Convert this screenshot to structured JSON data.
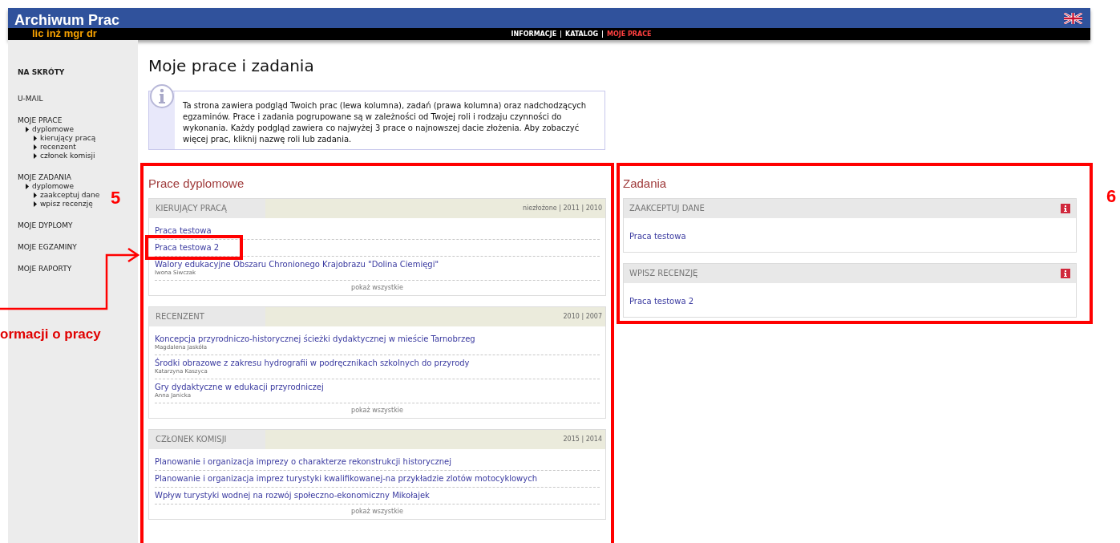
{
  "header": {
    "title": "Archiwum Prac",
    "subtitle": "lic inż mgr dr",
    "separator": "|",
    "nav": [
      {
        "label": "INFORMACJE",
        "selected": false
      },
      {
        "label": "KATALOG",
        "selected": false
      },
      {
        "label": "MOJE PRACE",
        "selected": true
      }
    ]
  },
  "sidebar": {
    "heading": "NA SKRÓTY",
    "items": [
      {
        "label": "U-MAIL"
      },
      {
        "label": "MOJE PRACE",
        "children": [
          {
            "label": "dyplomowe",
            "children": [
              {
                "label": "kierujący pracą"
              },
              {
                "label": "recenzent"
              },
              {
                "label": "członek komisji"
              }
            ]
          }
        ]
      },
      {
        "label": "MOJE ZADANIA",
        "children": [
          {
            "label": "dyplomowe",
            "children": [
              {
                "label": "zaakceptuj dane"
              },
              {
                "label": "wpisz recenzję"
              }
            ]
          }
        ]
      },
      {
        "label": "MOJE DYPLOMY"
      },
      {
        "label": "MOJE EGZAMINY"
      },
      {
        "label": "MOJE RAPORTY"
      }
    ]
  },
  "page_title": "Moje prace i zadania",
  "info_text": "Ta strona zawiera podgląd Twoich prac (lewa kolumna), zadań (prawa kolumna) oraz nadchodzących egzaminów. Prace i zadania pogrupowane są w zależności od Twojej roli i rodzaju czynności do wykonania. Każdy podgląd zawiera co najwyżej 3 prace o najnowszej dacie złożenia. Aby zobaczyć więcej prac, kliknij nazwę roli lub zadania.",
  "theses": {
    "title": "Prace dyplomowe",
    "groups": [
      {
        "heading": "KIERUJĄCY PRACĄ",
        "filters": "niezłożone | 2011 | 2010",
        "show_all": "pokaż wszystkie",
        "items": [
          {
            "title": "Praca testowa"
          },
          {
            "title": "Praca testowa 2",
            "highlighted": true
          },
          {
            "title": "Walory edukacyjne Obszaru Chronionego Krajobrazu \"Dolina Ciemięgi\"",
            "author": "Iwona Siwczak"
          }
        ]
      },
      {
        "heading": "RECENZENT",
        "filters": "2010 | 2007",
        "show_all": "pokaż wszystkie",
        "items": [
          {
            "title": "Koncepcja przyrodniczo-historycznej ścieżki dydaktycznej w mieście Tarnobrzeg",
            "author": "Magdalena Jaskóła"
          },
          {
            "title": "Środki obrazowe z zakresu hydrografii w podręcznikach szkolnych do przyrody",
            "author": "Katarzyna Kaszyca"
          },
          {
            "title": "Gry dydaktyczne w edukacji przyrodniczej",
            "author": "Anna Janicka"
          }
        ]
      },
      {
        "heading": "CZŁONEK KOMISJI",
        "filters": "2015 | 2014",
        "show_all": "pokaż wszystkie",
        "items": [
          {
            "title": "Planowanie i organizacja imprezy o charakterze rekonstrukcji historycznej"
          },
          {
            "title": "Planowanie i organizacja imprez turystyki kwalifikowanej-na przykładzie zlotów motocyklowych"
          },
          {
            "title": "Wpływ turystyki wodnej na rozwój społeczno-ekonomiczny Mikołajek"
          }
        ]
      }
    ]
  },
  "tasks": {
    "title": "Zadania",
    "groups": [
      {
        "heading": "ZAAKCEPTUJ DANE",
        "items": [
          {
            "title": "Praca testowa"
          }
        ]
      },
      {
        "heading": "WPISZ RECENZJĘ",
        "items": [
          {
            "title": "Praca testowa 2"
          }
        ]
      }
    ]
  },
  "annotations": [
    {
      "kind": "number",
      "text": "5"
    },
    {
      "kind": "number",
      "text": "6"
    },
    {
      "kind": "callout",
      "text": "ormacji o pracy"
    }
  ]
}
